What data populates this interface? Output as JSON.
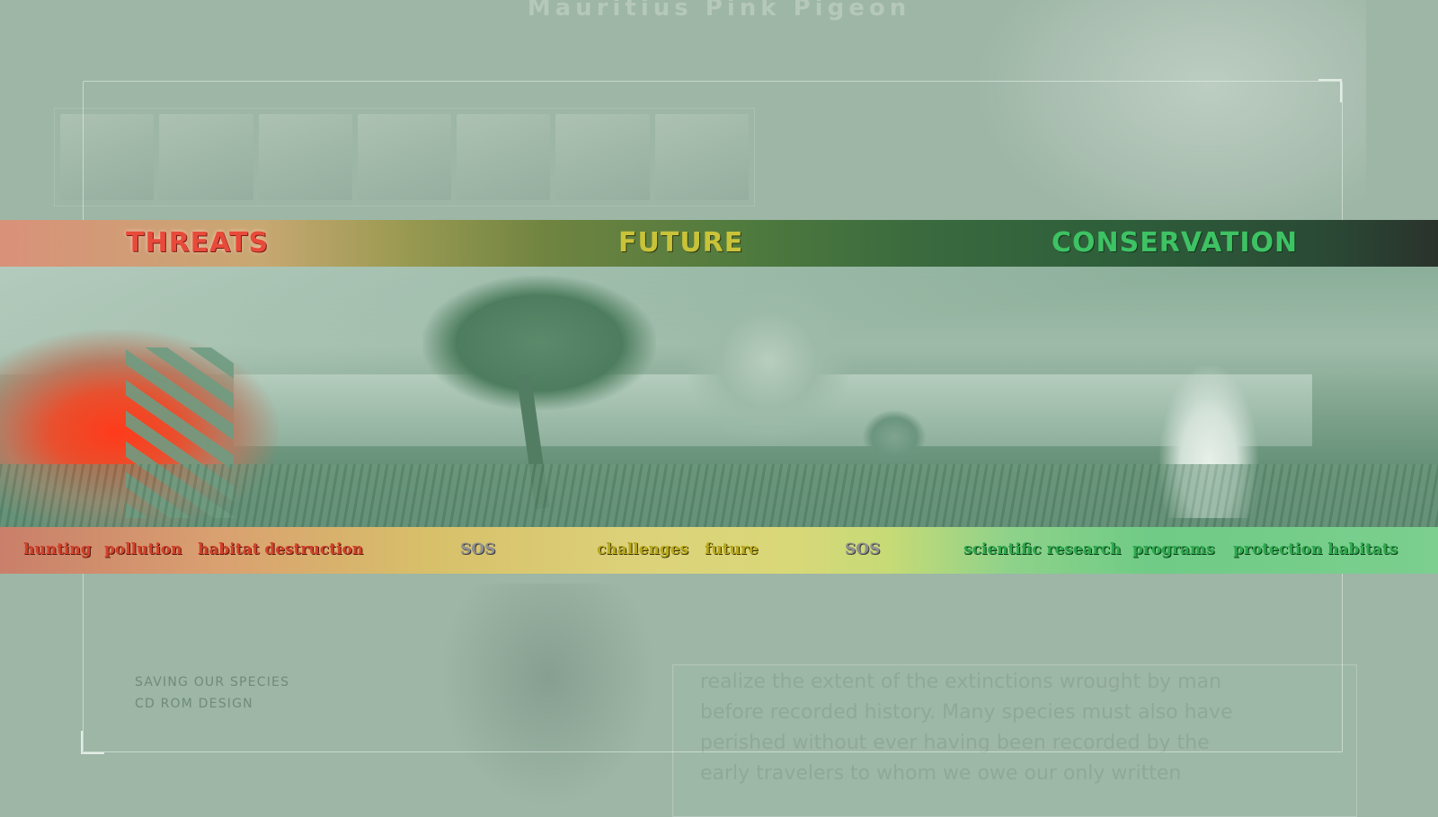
{
  "background": {
    "title": "Mauritius Pink Pigeon",
    "body_text": [
      "realize the extent of the extinctions wrought by man",
      "before recorded history. Many species must also have",
      "perished without ever having been recorded by the",
      "early travelers to whom we owe our only written"
    ]
  },
  "banner": {
    "tabs": {
      "threats": "THREATS",
      "future": "FUTURE",
      "conservation": "CONSERVATION"
    },
    "links": {
      "hunting": "hunting",
      "pollution": "pollution",
      "habitat_destruction": "habitat destruction",
      "sos_1": "SOS",
      "challenges": "challenges",
      "future": "future",
      "sos_2": "SOS",
      "scientific_research": "scientific research",
      "programs": "programs",
      "protection_habitats": "protection habitats"
    }
  },
  "caption": {
    "line1": "SAVING OUR SPECIES",
    "line2": "CD ROM DESIGN"
  },
  "colors": {
    "threats": "#e84a3a",
    "future": "#c9c33a",
    "conservation": "#3ec264",
    "background": "#9db6a6"
  }
}
